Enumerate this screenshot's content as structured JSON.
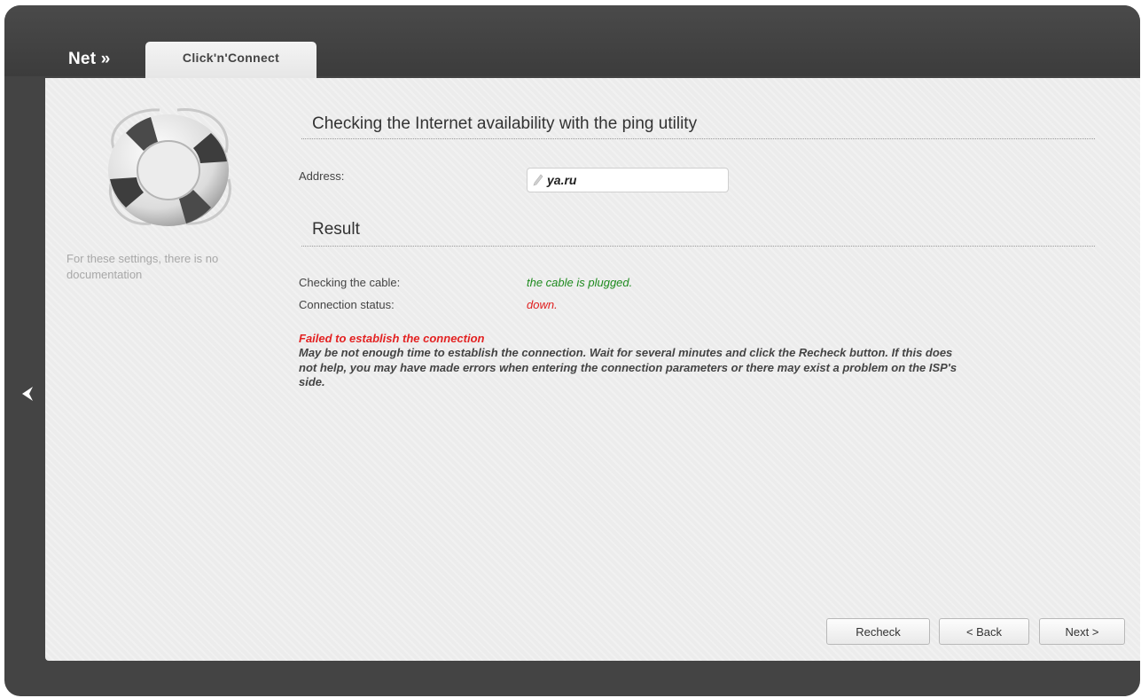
{
  "header": {
    "breadcrumb": "Net »",
    "tab_label": "Click'n'Connect"
  },
  "sidebar": {
    "help_icon": "lifebuoy-icon",
    "no_doc_text": "For these settings, there is no documentation",
    "back_arrow_icon": "chevron-left-icon"
  },
  "ping": {
    "title": "Checking the Internet availability with the ping utility",
    "address_label": "Address:",
    "address_value": "ya.ru",
    "edit_icon": "pencil-icon"
  },
  "result": {
    "title": "Result",
    "cable_label": "Checking the cable:",
    "cable_value": "the cable is plugged.",
    "status_label": "Connection status:",
    "status_value": "down.",
    "error_title": "Failed to establish the connection",
    "error_text": "May be not enough time to establish the connection. Wait for several minutes and click the Recheck button. If this does not help, you may have made errors when entering the connection parameters or there may exist a problem on the ISP's side."
  },
  "buttons": {
    "recheck": "Recheck",
    "back": "< Back",
    "next": "Next >"
  },
  "colors": {
    "success": "#1e8a1e",
    "error": "#e02020",
    "frame": "#444444"
  }
}
